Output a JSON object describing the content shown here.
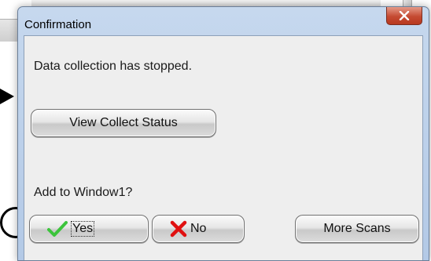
{
  "dialog": {
    "title": "Confirmation",
    "close_icon": "close-x-icon",
    "message": "Data collection has stopped.",
    "view_status_label": "View Collect Status",
    "question": "Add to Window1?",
    "buttons": {
      "yes_label": "Yes",
      "yes_icon": "checkmark-icon",
      "no_label": "No",
      "no_icon": "red-x-icon",
      "more_label": "More Scans"
    }
  },
  "colors": {
    "titlebar": "#c6d8ee",
    "close_button": "#c54a32",
    "checkmark": "#3cc43c",
    "no_x": "#e01010"
  }
}
